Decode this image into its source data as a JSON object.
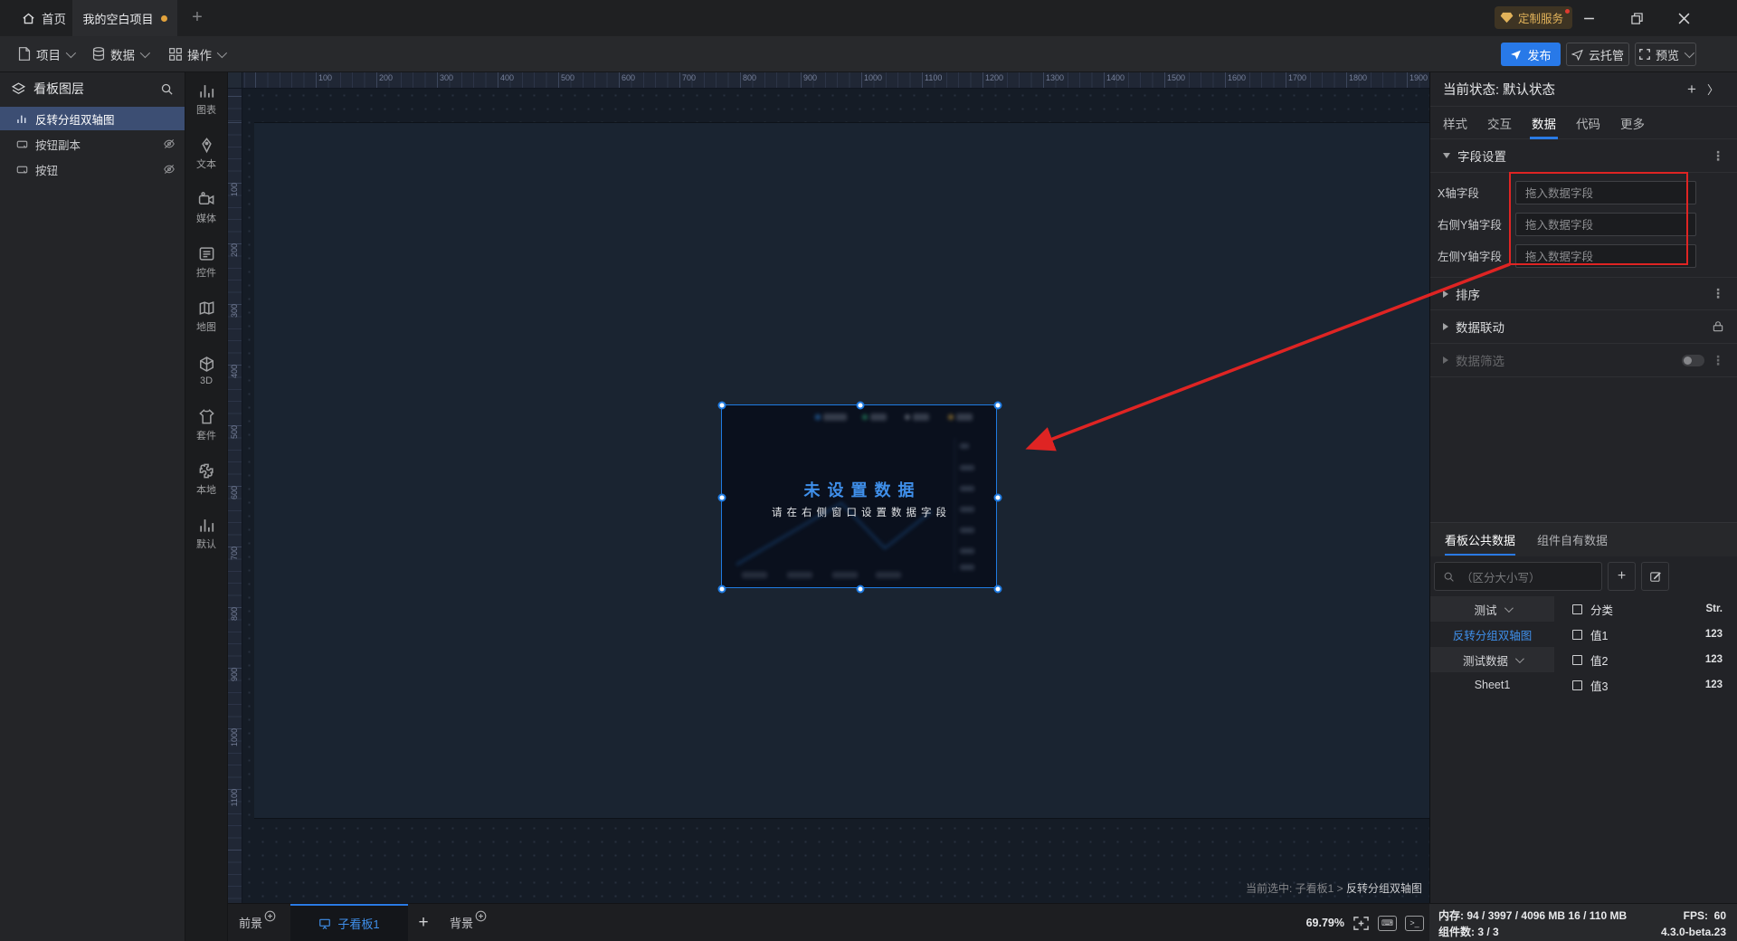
{
  "colors": {
    "accent": "#2a7ae4",
    "annotation_red": "#df2423",
    "link_blue": "#3f8fea",
    "badge_orange": "#e2b35a"
  },
  "titlebar": {
    "home": "首页",
    "project_tab": "我的空白项目",
    "vip_badge": "定制服务"
  },
  "menubar": {
    "items": [
      {
        "label": "项目"
      },
      {
        "label": "数据"
      },
      {
        "label": "操作"
      }
    ],
    "publish": "发布",
    "cloud_host": "云托管",
    "preview": "预览"
  },
  "layers_panel": {
    "title": "看板图层",
    "items": [
      {
        "label": "反转分组双轴图",
        "selected": true,
        "hidden": false
      },
      {
        "label": "按钮副本",
        "selected": false,
        "hidden": true
      },
      {
        "label": "按钮",
        "selected": false,
        "hidden": true
      }
    ]
  },
  "toolbar": {
    "items": [
      "图表",
      "文本",
      "媒体",
      "控件",
      "地图",
      "3D",
      "套件",
      "本地",
      "默认"
    ]
  },
  "canvas": {
    "ruler_h": [
      100,
      200,
      300,
      400,
      500,
      600,
      700,
      800,
      900,
      1000,
      1100,
      1200,
      1300,
      1400,
      1500,
      1600,
      1700,
      1800,
      1900
    ],
    "ruler_v": [
      100,
      200,
      300,
      400,
      500,
      600,
      700,
      800,
      900,
      1000,
      1100
    ],
    "zoom_level": "69.79%",
    "selected_path_prefix": "当前选中: 子看板1 > ",
    "selected_component": "反转分组双轴图",
    "chart_placeholder": {
      "title": "未设置数据",
      "subtitle": "请在右侧窗口设置数据字段"
    }
  },
  "bottombar": {
    "foreground": "前景",
    "subboard_tab": "子看板1",
    "background": "背景"
  },
  "inspector": {
    "state_label": "当前状态: 默认状态",
    "tabs": [
      {
        "label": "样式"
      },
      {
        "label": "交互"
      },
      {
        "label": "数据"
      },
      {
        "label": "代码"
      },
      {
        "label": "更多"
      }
    ],
    "active_tab": "数据",
    "field_settings_title": "字段设置",
    "fields": [
      {
        "label": "X轴字段",
        "placeholder": "拖入数据字段"
      },
      {
        "label": "右侧Y轴字段",
        "placeholder": "拖入数据字段"
      },
      {
        "label": "左侧Y轴字段",
        "placeholder": "拖入数据字段"
      }
    ],
    "sort_title": "排序",
    "linkage_title": "数据联动",
    "filter_title": "数据筛选"
  },
  "data_panel": {
    "tabs": [
      {
        "label": "看板公共数据"
      },
      {
        "label": "组件自有数据"
      }
    ],
    "active_tab": "看板公共数据",
    "search_placeholder": "（区分大小写）",
    "tree": [
      {
        "label": "测试",
        "kind": "folder"
      },
      {
        "label": "反转分组双轴图",
        "kind": "sheet-active"
      },
      {
        "label": "测试数据",
        "kind": "folder"
      },
      {
        "label": "Sheet1",
        "kind": "sheet"
      }
    ],
    "fields": [
      {
        "name": "分类",
        "type": "Str."
      },
      {
        "name": "值1",
        "type": "123"
      },
      {
        "name": "值2",
        "type": "123"
      },
      {
        "name": "值3",
        "type": "123"
      }
    ]
  },
  "statusbar": {
    "memory_label": "内存:",
    "memory_value": "94 / 3997 / 4096 MB  16 / 110 MB",
    "fps_label": "FPS:",
    "fps_value": "60",
    "components_label": "组件数:",
    "components_value": "3 / 3",
    "version": "4.3.0-beta.23"
  }
}
